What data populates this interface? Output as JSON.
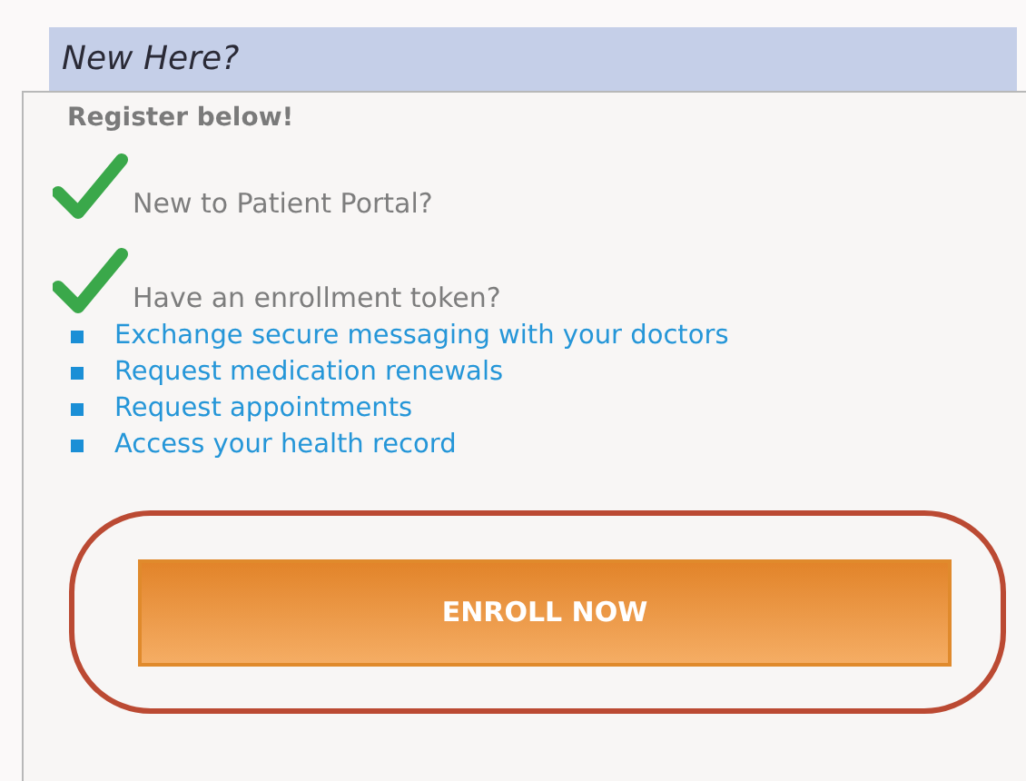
{
  "header": {
    "title": "New Here?"
  },
  "subtitle": "Register below!",
  "checks": [
    {
      "label": "New to Patient Portal?"
    },
    {
      "label": "Have an enrollment token?"
    }
  ],
  "features": [
    "Exchange secure messaging with your doctors",
    "Request medication renewals",
    "Request appointments",
    "Access your health record"
  ],
  "enroll_button": {
    "label": "ENROLL NOW",
    "highlighted": true
  }
}
